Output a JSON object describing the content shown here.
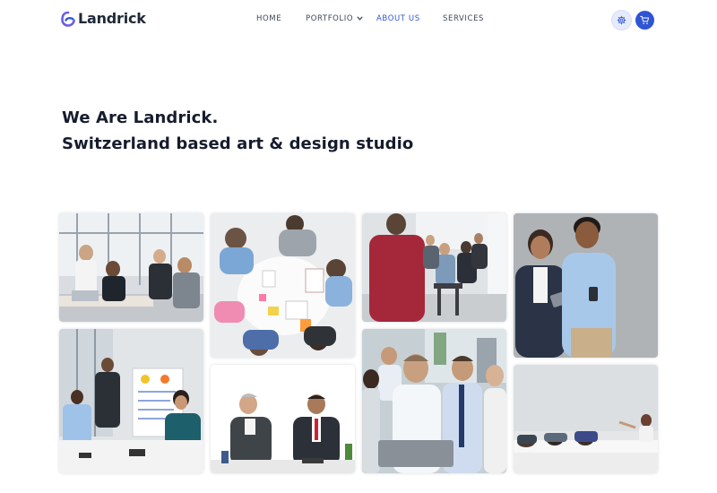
{
  "brand": {
    "name": "Landrick",
    "accent": "#2f55d4"
  },
  "nav": {
    "items": [
      {
        "label": "HOME",
        "active": false
      },
      {
        "label": "PORTFOLIO",
        "active": false,
        "has_dropdown": true
      },
      {
        "label": "ABOUT US",
        "active": true
      },
      {
        "label": "SERVICES",
        "active": false
      }
    ],
    "actions": [
      {
        "icon": "gear-icon"
      },
      {
        "icon": "cart-icon"
      }
    ]
  },
  "hero": {
    "line1": "We Are Landrick.",
    "line2": "Switzerland based art & design studio"
  },
  "gallery": {
    "images": [
      {
        "icon": "team-celebrating-photo"
      },
      {
        "icon": "team-meeting-top-view-photo"
      },
      {
        "icon": "presentation-audience-photo"
      },
      {
        "icon": "two-colleagues-smiling-photo"
      },
      {
        "icon": "whiteboard-presentation-photo"
      },
      {
        "icon": "two-businessmen-talking-photo"
      },
      {
        "icon": "group-portrait-laptop-photo"
      },
      {
        "icon": "tired-team-at-table-photo"
      }
    ]
  }
}
